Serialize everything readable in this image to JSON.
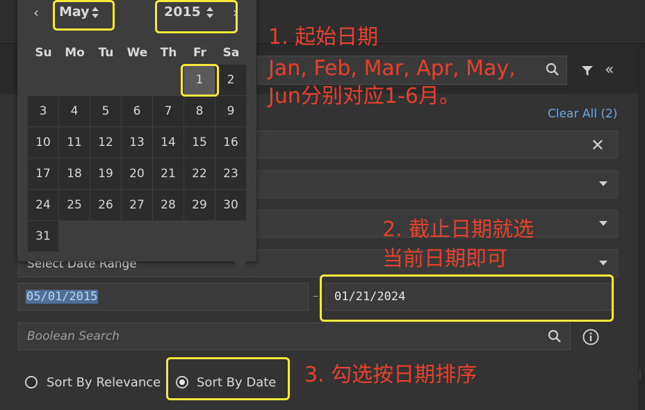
{
  "search_panel": {
    "clear_all": "Clear All (2)",
    "date_range_select": "Select Date Range",
    "date_from": "05/01/2015",
    "date_separator": "–",
    "date_to": "01/21/2024",
    "boolean_search_placeholder": "Boolean Search"
  },
  "calendar": {
    "month": "May",
    "year": "2015",
    "weekdays": [
      "Su",
      "Mo",
      "Tu",
      "We",
      "Th",
      "Fr",
      "Sa"
    ],
    "days": [
      "1",
      "2",
      "3",
      "4",
      "5",
      "6",
      "7",
      "8",
      "9",
      "10",
      "11",
      "12",
      "13",
      "14",
      "15",
      "16",
      "17",
      "18",
      "19",
      "20",
      "21",
      "22",
      "23",
      "24",
      "25",
      "26",
      "27",
      "28",
      "29",
      "30",
      "31"
    ],
    "selected_day": "1"
  },
  "sort": {
    "relevance_label": "Sort By Relevance",
    "date_label": "Sort By Date",
    "selected": "Sort By Date"
  },
  "annotations": {
    "note1_line1": "1. 起始日期",
    "note1_line2": "Jan, Feb, Mar, Apr, May,",
    "note1_line3": "Jun分别对应1-6月。",
    "note2_line1": "2. 截止日期就选",
    "note2_line2": "当前日期即可",
    "note3": "3. 勾选按日期排序",
    "highlight_color": "#f5e93a",
    "note_color": "#e8402e"
  }
}
